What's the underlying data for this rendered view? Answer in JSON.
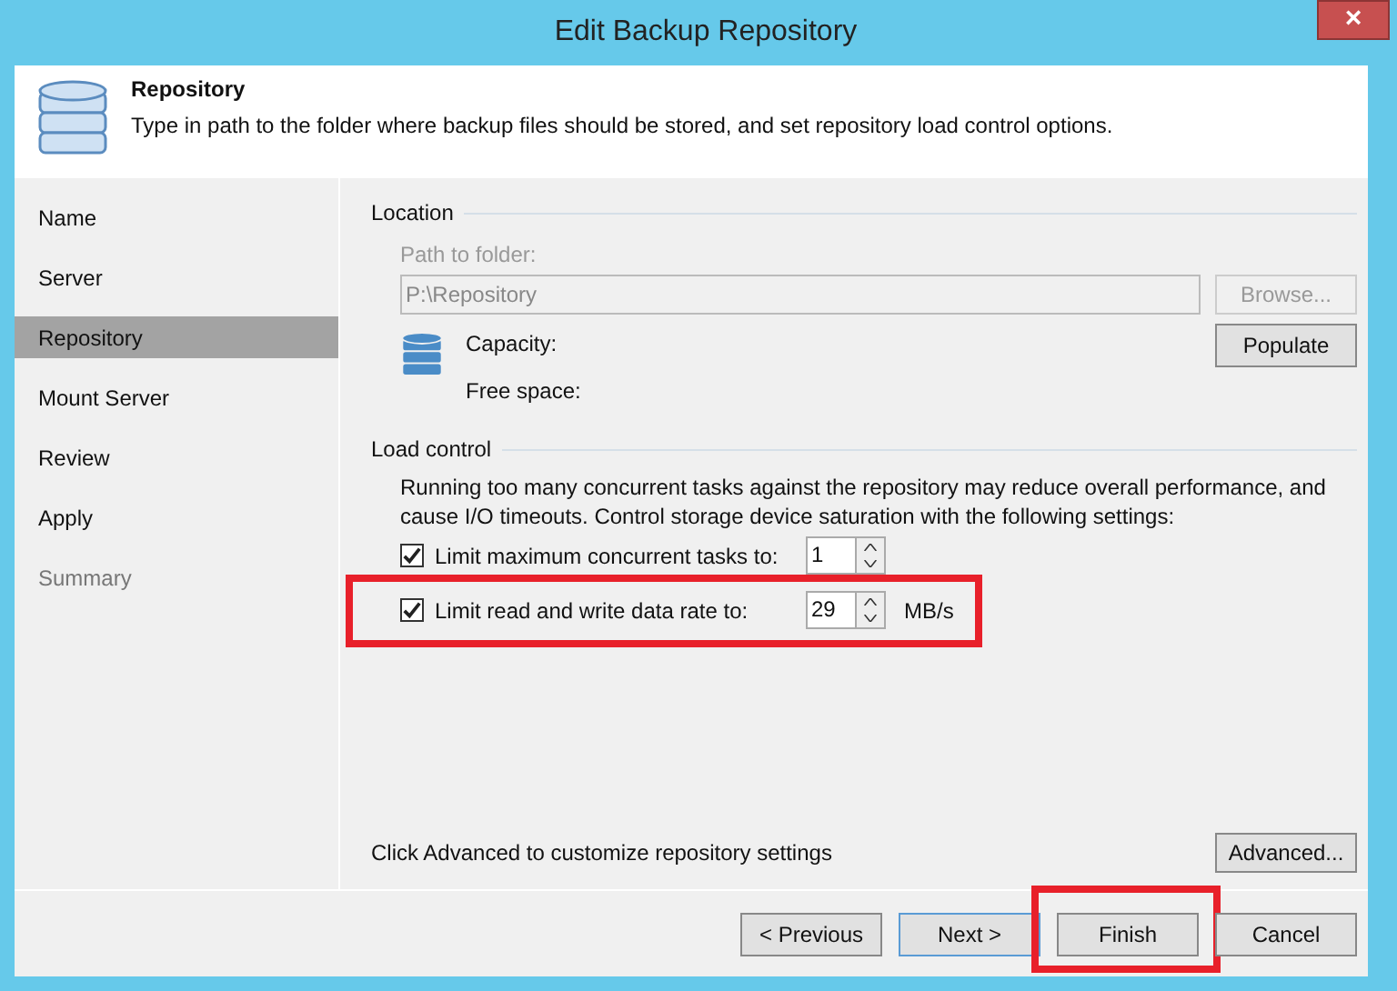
{
  "window": {
    "title": "Edit Backup Repository",
    "close": "×"
  },
  "header": {
    "title": "Repository",
    "description": "Type in path to the folder where backup files should be stored, and set repository load control options."
  },
  "steps": [
    {
      "label": "Name",
      "selected": false,
      "disabled": false
    },
    {
      "label": "Server",
      "selected": false,
      "disabled": false
    },
    {
      "label": "Repository",
      "selected": true,
      "disabled": false
    },
    {
      "label": "Mount Server",
      "selected": false,
      "disabled": false
    },
    {
      "label": "Review",
      "selected": false,
      "disabled": false
    },
    {
      "label": "Apply",
      "selected": false,
      "disabled": false
    },
    {
      "label": "Summary",
      "selected": false,
      "disabled": true
    }
  ],
  "location": {
    "heading": "Location",
    "path_label": "Path to folder:",
    "path_value": "P:\\Repository",
    "path_disabled": true,
    "browse": "Browse...",
    "browse_disabled": true,
    "capacity": "Capacity:",
    "free_space": "Free space:",
    "populate": "Populate"
  },
  "load_control": {
    "heading": "Load control",
    "description": "Running too many concurrent tasks against the repository may reduce overall performance, and cause I/O timeouts. Control storage device saturation with the following settings:",
    "options": [
      {
        "label": "Limit maximum concurrent tasks to:",
        "checked": true,
        "value": "1",
        "highlighted": false
      },
      {
        "label": "Limit read and write data rate to:",
        "checked": true,
        "value": "29",
        "unit": "MB/s",
        "highlighted": true
      }
    ]
  },
  "advanced": {
    "text": "Click Advanced to customize repository settings",
    "button": "Advanced..."
  },
  "buttons": [
    {
      "label": "< Previous",
      "highlighted": false
    },
    {
      "label": "Next >",
      "highlighted": false
    },
    {
      "label": "Finish",
      "highlighted": true
    },
    {
      "label": "Cancel",
      "highlighted": false
    }
  ]
}
